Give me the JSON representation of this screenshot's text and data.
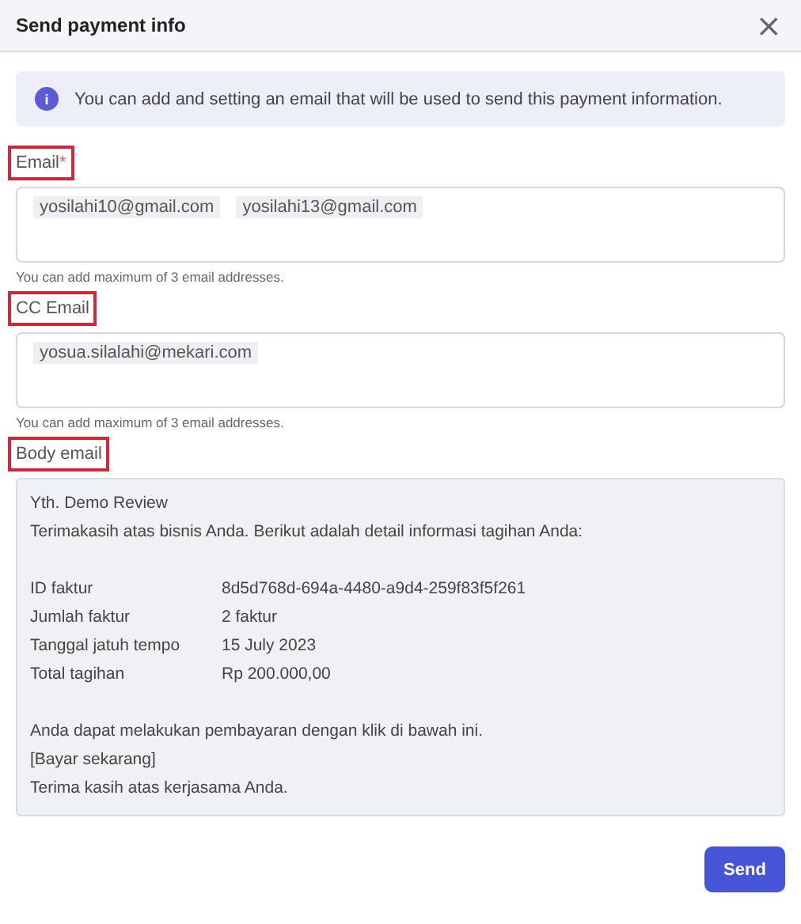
{
  "dialog": {
    "title": "Send payment info",
    "close": "×"
  },
  "info_banner": {
    "icon": "i",
    "text": "You can add and setting an email that will be used to send this payment information."
  },
  "fields": [
    {
      "label": "Email",
      "required_mark": "*",
      "highlighted": true,
      "chips": [
        "yosilahi10@gmail.com",
        "yosilahi13@gmail.com"
      ],
      "hint": "You can add maximum of 3 email addresses."
    },
    {
      "label": "CC Email",
      "highlighted": true,
      "chips": [
        "yosua.silalahi@mekari.com"
      ],
      "hint": "You can add maximum of 3 email addresses."
    }
  ],
  "body_email": {
    "label": "Body email",
    "highlighted": true,
    "greeting": "Yth. Demo Review",
    "intro": "Terimakasih atas bisnis Anda. Berikut adalah detail informasi tagihan Anda:",
    "details": [
      {
        "label": "ID faktur",
        "value": "8d5d768d-694a-4480-a9d4-259f83f5f261"
      },
      {
        "label": "Jumlah faktur",
        "value": "2 faktur"
      },
      {
        "label": "Tanggal jatuh tempo",
        "value": "15 July 2023"
      },
      {
        "label": "Total tagihan",
        "value": "Rp 200.000,00"
      }
    ],
    "closing": [
      "Anda dapat melakukan pembayaran dengan klik di bawah ini.",
      "[Bayar sekarang]",
      "Terima kasih atas kerjasama Anda."
    ]
  },
  "buttons": [
    {
      "label": "Send"
    }
  ]
}
